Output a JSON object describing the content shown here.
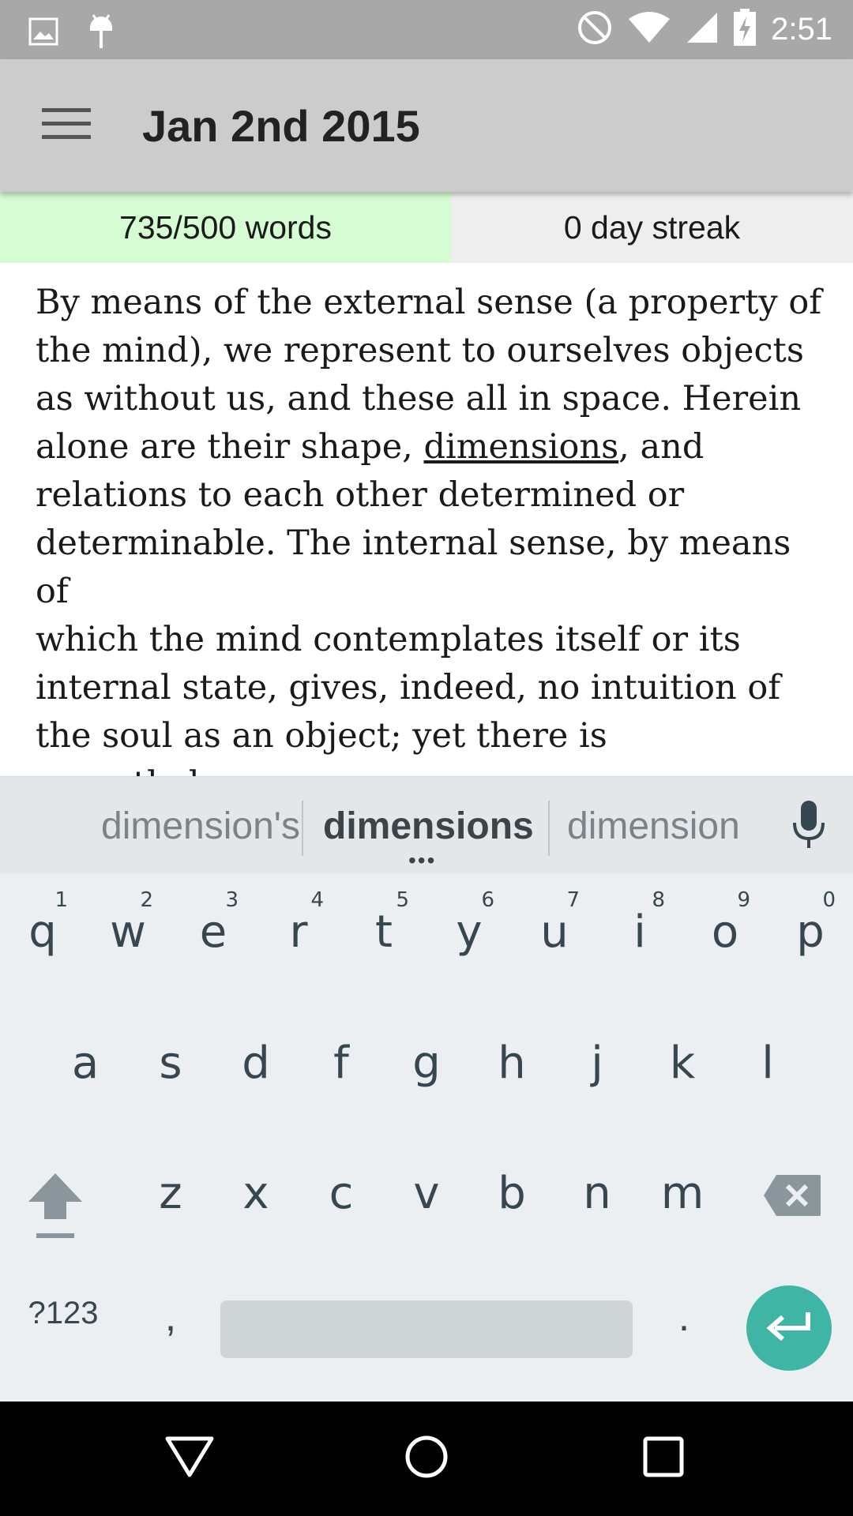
{
  "status_bar": {
    "time": "2:51",
    "icons": [
      "image-icon",
      "android-icon",
      "do-not-disturb-icon",
      "wifi-icon",
      "signal-icon",
      "battery-charging-icon"
    ]
  },
  "app_bar": {
    "title": "Jan 2nd 2015",
    "menu_icon": "hamburger-menu-icon"
  },
  "stats": {
    "word_count": "735/500 words",
    "streak": "0 day streak",
    "word_count_bg": "#d6fcd4",
    "streak_bg": "#eeeeee"
  },
  "editor": {
    "text_before": "By means of the external sense (a property of\nthe mind), we represent to ourselves objects\nas without us, and these all in space. Herein\nalone are their shape, ",
    "underlined_word": "dimensions",
    "text_after": ", and\nrelations to each other determined or\ndeterminable. The internal sense, by means of\nwhich the mind contemplates itself or its\ninternal state, gives, indeed, no intuition of\nthe soul as an object; yet there is nevertheless\na determinate form, under which alone the\ncontemplation of our internal state is"
  },
  "keyboard": {
    "suggestions": [
      "dimension's",
      "dimensions",
      "dimension"
    ],
    "row1": [
      {
        "k": "q",
        "h": "1"
      },
      {
        "k": "w",
        "h": "2"
      },
      {
        "k": "e",
        "h": "3"
      },
      {
        "k": "r",
        "h": "4"
      },
      {
        "k": "t",
        "h": "5"
      },
      {
        "k": "y",
        "h": "6"
      },
      {
        "k": "u",
        "h": "7"
      },
      {
        "k": "i",
        "h": "8"
      },
      {
        "k": "o",
        "h": "9"
      },
      {
        "k": "p",
        "h": "0"
      }
    ],
    "row2": [
      "a",
      "s",
      "d",
      "f",
      "g",
      "h",
      "j",
      "k",
      "l"
    ],
    "row3": [
      "z",
      "x",
      "c",
      "v",
      "b",
      "n",
      "m"
    ],
    "symbols_label": "?123",
    "comma_label": ",",
    "period_label": ".",
    "enter_color": "#3fb5a5"
  },
  "nav_bar": {
    "buttons": [
      "back-icon",
      "home-icon",
      "recents-icon"
    ]
  }
}
